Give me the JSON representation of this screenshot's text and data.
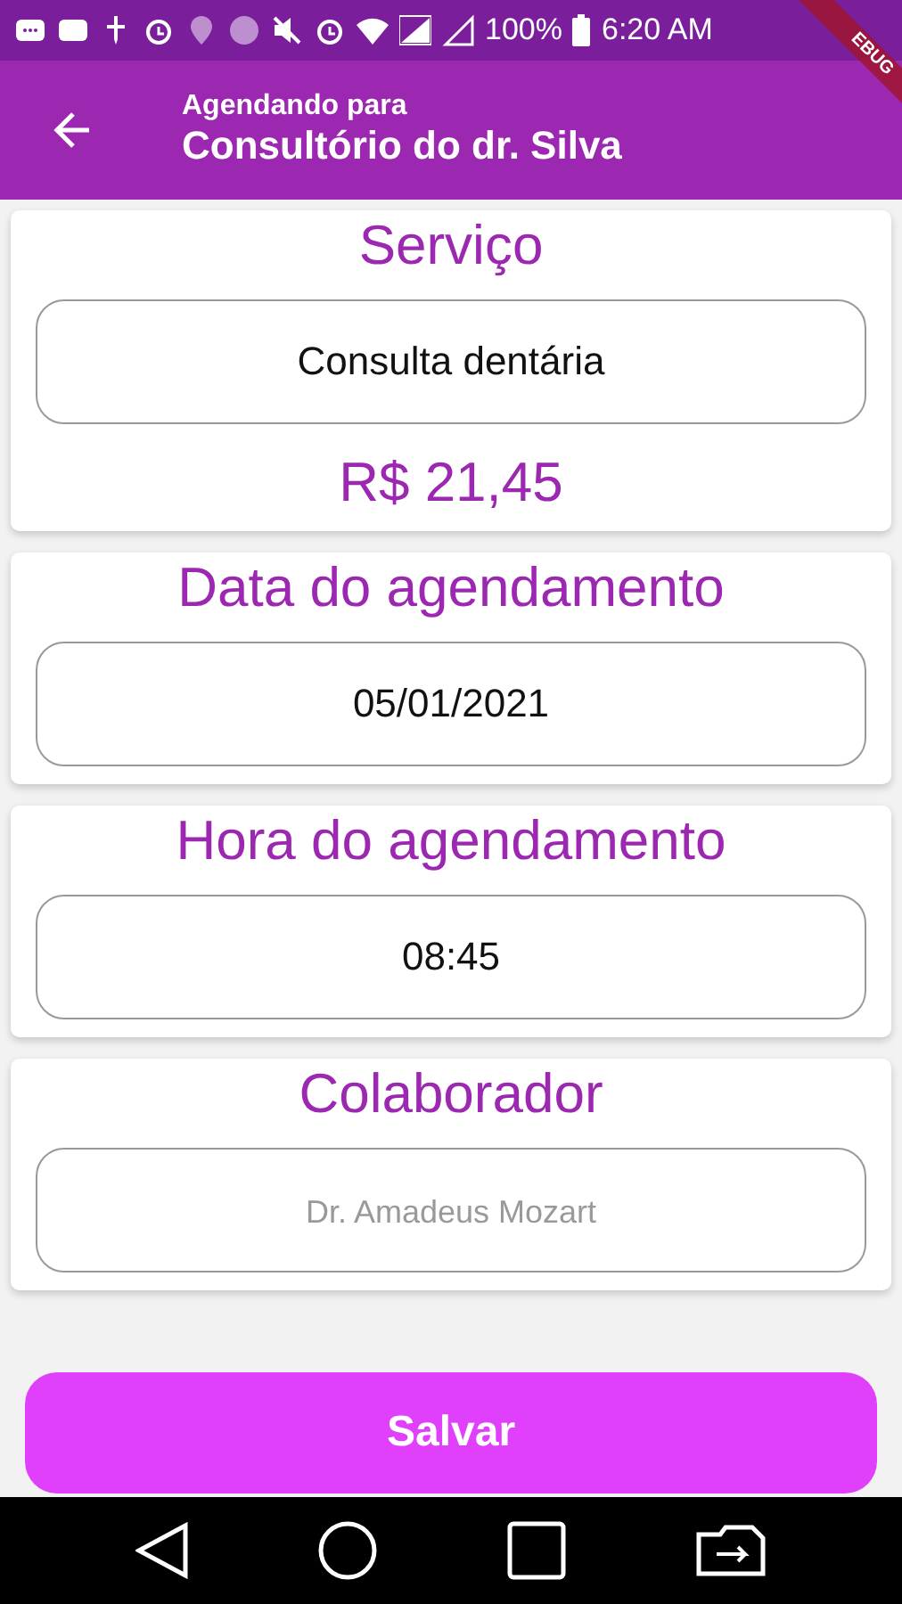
{
  "status_bar": {
    "battery": "100%",
    "time": "6:20 AM"
  },
  "debug_banner": "EBUG",
  "app_bar": {
    "subtitle": "Agendando para",
    "title": "Consultório do dr. Silva"
  },
  "sections": [
    {
      "title": "Serviço",
      "field": {
        "value": "Consulta dentária"
      },
      "price": "R$ 21,45"
    },
    {
      "title": "Data do agendamento",
      "field": {
        "value": "05/01/2021"
      }
    },
    {
      "title": "Hora do agendamento",
      "field": {
        "value": "08:45"
      }
    },
    {
      "title": "Colaborador",
      "field": {
        "placeholder": "Dr. Amadeus Mozart"
      }
    }
  ],
  "save_button": "Salvar"
}
